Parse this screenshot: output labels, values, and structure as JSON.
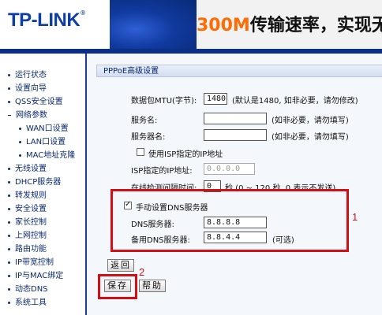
{
  "header": {
    "logo": "TP-LINK",
    "logo_mark": "®",
    "slogan_highlight": "300M",
    "slogan_rest": "传输速率，实现无线"
  },
  "sidebar": {
    "items": [
      {
        "label": "运行状态"
      },
      {
        "label": "设置向导"
      },
      {
        "label": "QSS安全设置"
      },
      {
        "label": "网络参数"
      },
      {
        "label": "WAN口设置"
      },
      {
        "label": "LAN口设置"
      },
      {
        "label": "MAC地址克隆"
      },
      {
        "label": "无线设置"
      },
      {
        "label": "DHCP服务器"
      },
      {
        "label": "转发规则"
      },
      {
        "label": "安全设置"
      },
      {
        "label": "家长控制"
      },
      {
        "label": "上网控制"
      },
      {
        "label": "路由功能"
      },
      {
        "label": "IP带宽控制"
      },
      {
        "label": "IP与MAC绑定"
      },
      {
        "label": "动态DNS"
      },
      {
        "label": "系统工具"
      }
    ]
  },
  "panel": {
    "title": "PPPoE高级设置",
    "mtu_label": "数据包MTU(字节):",
    "mtu_value": "1480",
    "mtu_hint": "(默认是1480, 如非必要，请勿修改)",
    "service_name_label": "服务名:",
    "service_name_value": "",
    "service_name_hint": "(如非必要，请勿填写)",
    "server_name_label": "服务器名:",
    "server_name_value": "",
    "server_name_hint": "(如非必要，请勿填写)",
    "isp_ip_checkbox_label": "使用ISP指定的IP地址",
    "isp_ip_label": "ISP指定的IP地址:",
    "isp_ip_value": "0.0.0.0",
    "online_detect_label": "在线检测间隔时间:",
    "online_detect_value": "0",
    "online_detect_hint": "秒 (0 ~ 120 秒, 0 表示不发送)",
    "manual_dns_label": "手动设置DNS服务器",
    "manual_dns_checked": true,
    "dns_label": "DNS服务器:",
    "dns_value": "8.8.8.8",
    "backup_dns_label": "备用DNS服务器:",
    "backup_dns_value": "8.8.4.4",
    "backup_dns_hint": "(可选)",
    "back_button": "返回",
    "save_button": "保存",
    "help_button": "帮助"
  },
  "annotations": {
    "box1_label": "1",
    "box2_label": "2",
    "color": "#d40f14"
  }
}
